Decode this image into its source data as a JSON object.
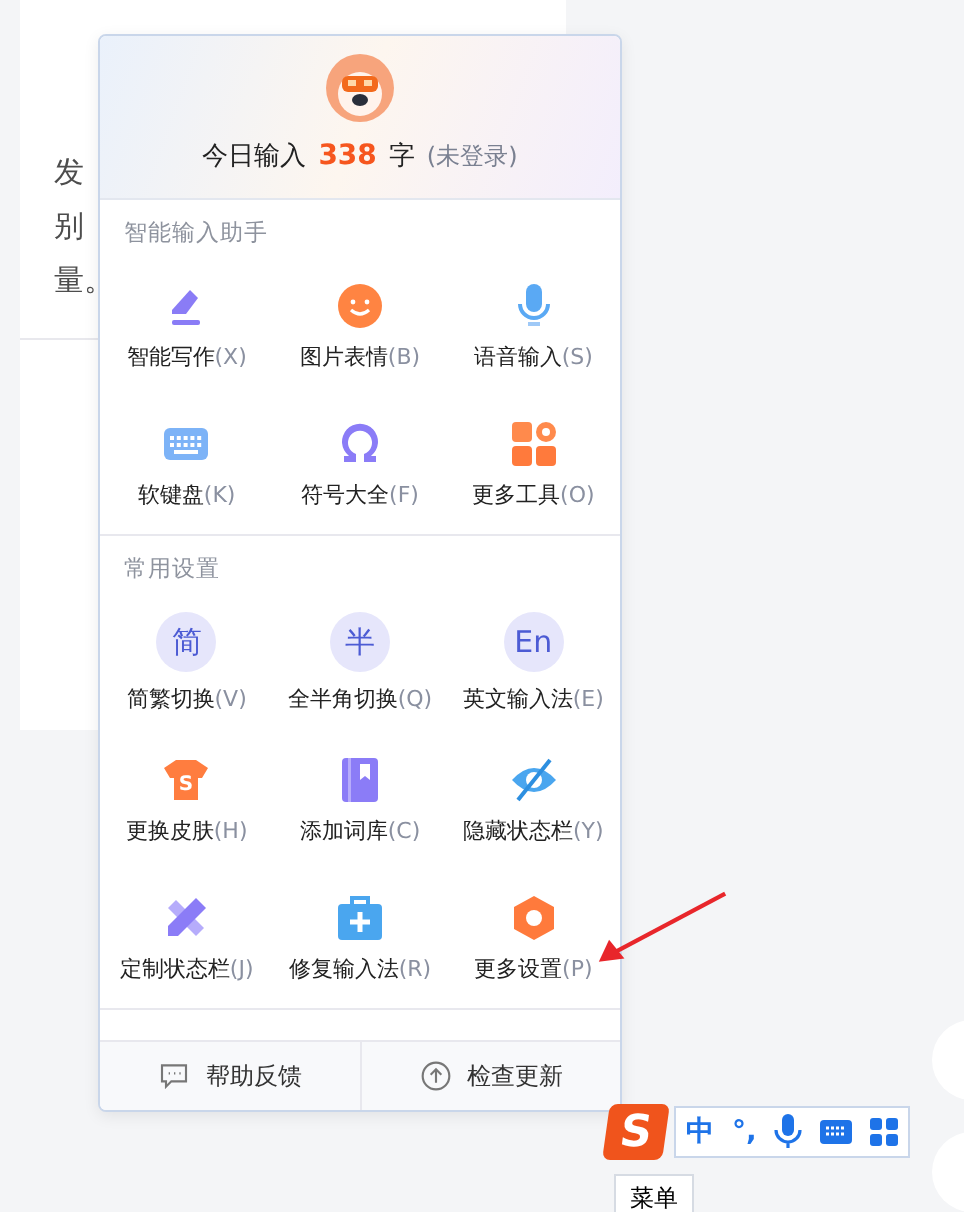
{
  "article": {
    "lines": [
      "发",
      "别",
      "量。"
    ]
  },
  "panel": {
    "stats": {
      "prefix": "今日输入",
      "count": "338",
      "unit": "字",
      "login": "(未登录)"
    },
    "sections": [
      {
        "title": "智能输入助手",
        "items": [
          {
            "label": "智能写作",
            "key": "(X)"
          },
          {
            "label": "图片表情",
            "key": "(B)"
          },
          {
            "label": "语音输入",
            "key": "(S)"
          },
          {
            "label": "软键盘",
            "key": "(K)"
          },
          {
            "label": "符号大全",
            "key": "(F)"
          },
          {
            "label": "更多工具",
            "key": "(O)"
          }
        ]
      },
      {
        "title": "常用设置",
        "items": [
          {
            "glyph": "简",
            "label": "简繁切换",
            "key": "(V)"
          },
          {
            "glyph": "半",
            "label": "全半角切换",
            "key": "(Q)"
          },
          {
            "glyph": "En",
            "label": "英文输入法",
            "key": "(E)"
          },
          {
            "glyph": "S",
            "label": "更换皮肤",
            "key": "(H)"
          },
          {
            "label": "添加词库",
            "key": "(C)"
          },
          {
            "label": "隐藏状态栏",
            "key": "(Y)"
          },
          {
            "label": "定制状态栏",
            "key": "(J)"
          },
          {
            "label": "修复输入法",
            "key": "(R)"
          },
          {
            "label": "更多设置",
            "key": "(P)"
          }
        ]
      }
    ],
    "footer": [
      {
        "label": "帮助反馈"
      },
      {
        "label": "检查更新"
      }
    ]
  },
  "toolbar": {
    "logo": "S",
    "items": [
      {
        "kind": "text",
        "text": "中"
      },
      {
        "kind": "text",
        "text": "°,"
      },
      {
        "kind": "mic"
      },
      {
        "kind": "keyboard"
      },
      {
        "kind": "apps"
      }
    ]
  },
  "tooltip": "菜单"
}
